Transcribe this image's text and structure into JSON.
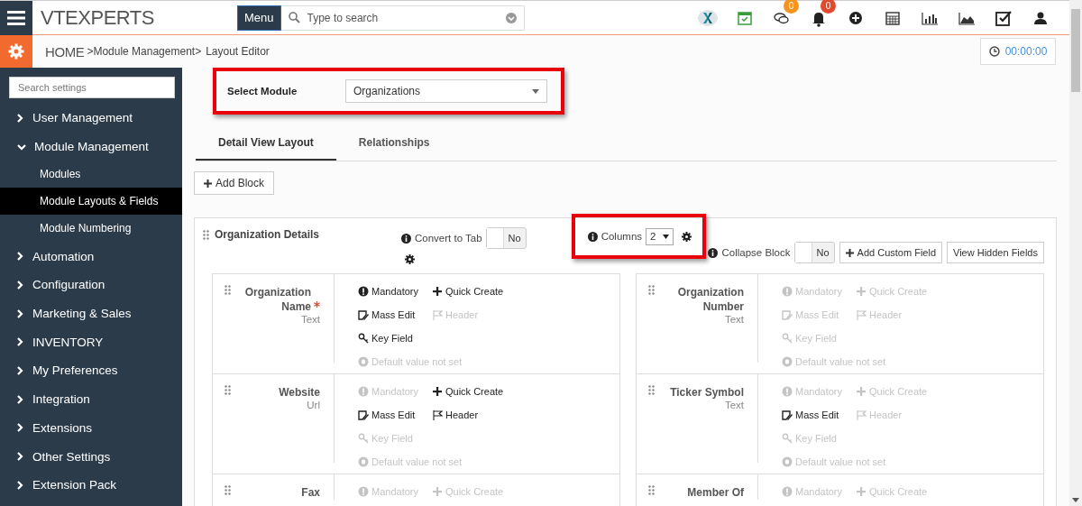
{
  "topbar": {
    "logo": "VTEXPERTS",
    "menu_button": "Menu",
    "search": {
      "placeholder": "Type to search"
    },
    "icons": [
      {
        "kind": "app"
      },
      {
        "kind": "calendar_check"
      },
      {
        "kind": "chat",
        "badge": "0",
        "color": "#f7941d"
      },
      {
        "kind": "bell",
        "badge": "0",
        "color": "#e2492f"
      },
      {
        "kind": "plus"
      },
      {
        "kind": "calendar"
      },
      {
        "kind": "bar_chart"
      },
      {
        "kind": "area_chart"
      },
      {
        "kind": "checkbox"
      },
      {
        "kind": "user"
      }
    ]
  },
  "breadcrumb": {
    "home": "HOME",
    "path": ">Module Management>",
    "current": "Layout Editor"
  },
  "timer": "00:00:00",
  "sidebar": {
    "search": {
      "placeholder": "Search settings"
    },
    "items": [
      {
        "label": "User Management",
        "expanded": false
      },
      {
        "label": "Module Management",
        "expanded": true,
        "children": [
          {
            "label": "Modules",
            "selected": false
          },
          {
            "label": "Module Layouts & Fields",
            "selected": true
          },
          {
            "label": "Module Numbering",
            "selected": false
          }
        ]
      },
      {
        "label": "Automation",
        "expanded": false
      },
      {
        "label": "Configuration",
        "expanded": false
      },
      {
        "label": "Marketing & Sales",
        "expanded": false
      },
      {
        "label": "INVENTORY",
        "expanded": false
      },
      {
        "label": "My Preferences",
        "expanded": false
      },
      {
        "label": "Integration",
        "expanded": false
      },
      {
        "label": "Extensions",
        "expanded": false
      },
      {
        "label": "Other Settings",
        "expanded": false
      },
      {
        "label": "Extension Pack",
        "expanded": false
      }
    ]
  },
  "select_module": {
    "label": "Select Module",
    "value": "Organizations",
    "highlighted": true
  },
  "tabs": [
    {
      "label": "Detail View Layout",
      "selected": true
    },
    {
      "label": "Relationships",
      "selected": false
    }
  ],
  "add_block_button": "Add Block",
  "block": {
    "title": "Organization Details",
    "convert_to_tab": {
      "label": "Convert to Tab",
      "on": false,
      "value": "No"
    },
    "columns": {
      "label": "Columns",
      "value": "2",
      "highlighted": true
    },
    "collapse_block": {
      "label": "Collapse Block",
      "on": false,
      "value": "No"
    },
    "buttons": [
      {
        "kind": "add",
        "label": "Add Custom Field"
      },
      {
        "kind": "plain",
        "label": "View Hidden Fields"
      }
    ],
    "fields": [
      {
        "label": "Organization Name",
        "required": true,
        "type": "Text",
        "options": [
          {
            "kind": "mandatory",
            "label": "Mandatory",
            "enabled": true
          },
          {
            "kind": "quick_create",
            "label": "Quick Create",
            "enabled": true
          },
          {
            "kind": "mass_edit",
            "label": "Mass Edit",
            "enabled": true
          },
          {
            "kind": "header",
            "label": "Header",
            "enabled": false
          },
          {
            "kind": "key_field",
            "label": "Key Field",
            "enabled": true
          },
          {
            "kind": "default_value",
            "label": "Default value not set",
            "enabled": false
          }
        ]
      },
      {
        "label": "Organization Number",
        "required": false,
        "type": "Text",
        "options": [
          {
            "kind": "mandatory",
            "label": "Mandatory",
            "enabled": false
          },
          {
            "kind": "quick_create",
            "label": "Quick Create",
            "enabled": false
          },
          {
            "kind": "mass_edit",
            "label": "Mass Edit",
            "enabled": false
          },
          {
            "kind": "header",
            "label": "Header",
            "enabled": false
          },
          {
            "kind": "key_field",
            "label": "Key Field",
            "enabled": false
          },
          {
            "kind": "default_value",
            "label": "Default value not set",
            "enabled": false
          }
        ]
      },
      {
        "label": "Website",
        "required": false,
        "type": "Url",
        "options": [
          {
            "kind": "mandatory",
            "label": "Mandatory",
            "enabled": false
          },
          {
            "kind": "quick_create",
            "label": "Quick Create",
            "enabled": true
          },
          {
            "kind": "mass_edit",
            "label": "Mass Edit",
            "enabled": true
          },
          {
            "kind": "header",
            "label": "Header",
            "enabled": true
          },
          {
            "kind": "key_field",
            "label": "Key Field",
            "enabled": false
          },
          {
            "kind": "default_value",
            "label": "Default value not set",
            "enabled": false
          }
        ]
      },
      {
        "label": "Ticker Symbol",
        "required": false,
        "type": "Text",
        "options": [
          {
            "kind": "mandatory",
            "label": "Mandatory",
            "enabled": false
          },
          {
            "kind": "quick_create",
            "label": "Quick Create",
            "enabled": false
          },
          {
            "kind": "mass_edit",
            "label": "Mass Edit",
            "enabled": true
          },
          {
            "kind": "header",
            "label": "Header",
            "enabled": false
          },
          {
            "kind": "key_field",
            "label": "Key Field",
            "enabled": false
          },
          {
            "kind": "default_value",
            "label": "Default value not set",
            "enabled": false
          }
        ]
      },
      {
        "label": "Fax",
        "required": false,
        "options": [
          {
            "kind": "mandatory",
            "label": "Mandatory",
            "enabled": false
          },
          {
            "kind": "quick_create",
            "label": "Quick Create",
            "enabled": false
          }
        ]
      },
      {
        "label": "Member Of",
        "required": false,
        "options": [
          {
            "kind": "mandatory",
            "label": "Mandatory",
            "enabled": false
          },
          {
            "kind": "quick_create",
            "label": "Quick Create",
            "enabled": false
          }
        ]
      }
    ]
  }
}
